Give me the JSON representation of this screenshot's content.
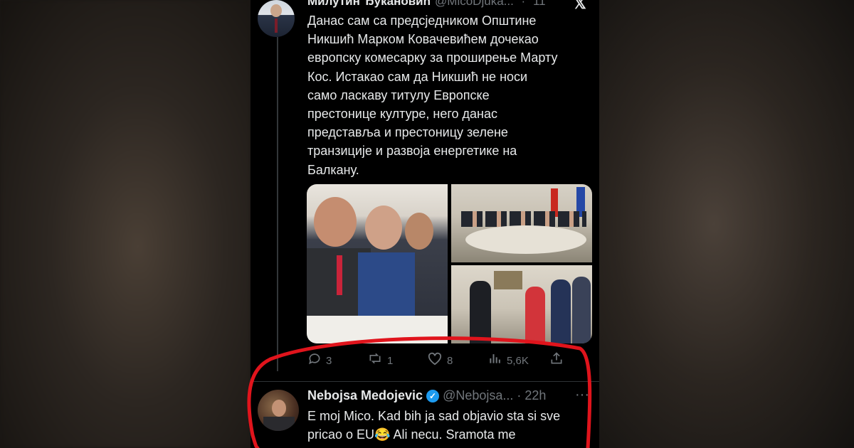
{
  "background": {
    "left_color": "#3d342c",
    "right_color": "#3f372f",
    "accent": "#e0141c"
  },
  "tweet": {
    "author_name": "Милутин Ђукановић",
    "author_handle": "@MicoDjuka...",
    "time": "11",
    "platform_icon": "x-logo-icon",
    "text_lines": [
      "Данас сам са предсједником Општине",
      "Никшић Марком Ковачевићем дочекао",
      "европску комесарку за проширење Марту",
      "Кос. Истакао сам да Никшић не носи",
      "само ласкаву титулу Европске",
      "престонице културе, него данас",
      "представља и престоницу зелене",
      "транзиције и развоја енергетике на",
      "Балкану."
    ],
    "images": [
      "meeting-closeup-photo",
      "round-table-photo",
      "handshake-photo"
    ],
    "actions": {
      "replies": "3",
      "reposts": "1",
      "likes": "8",
      "views": "5,6K"
    }
  },
  "reply": {
    "author_name": "Nebojsa Medojevic",
    "author_handle": "@Nebojsa...",
    "time": "22h",
    "verified": true,
    "text_lines": [
      "E moj Mico. Kad bih ja sad objavio sta si sve",
      "pricao o EU😂 Ali necu. Sramota me"
    ]
  }
}
